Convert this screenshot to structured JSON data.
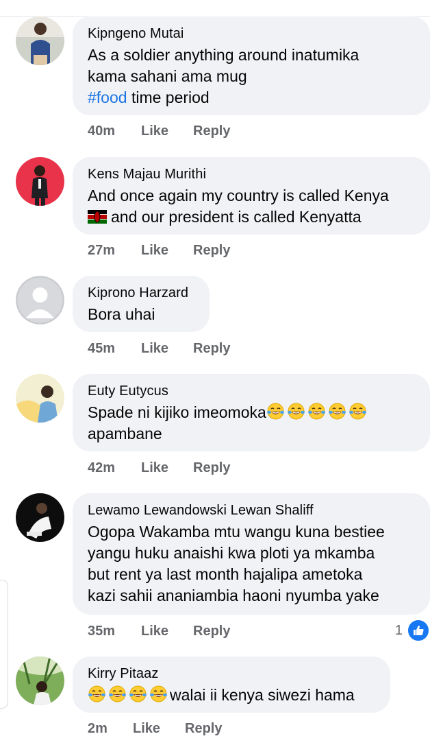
{
  "comments": [
    {
      "name": "Kipngeno Mutai",
      "line1": "As a soldier anything around inatumika",
      "line2": "kama sahani ama mug",
      "hashtag": "#food",
      "line3_rest": " time period",
      "time": "40m",
      "like": "Like",
      "reply": "Reply"
    },
    {
      "name": "Kens Majau Murithi",
      "line1": "And once again my country is called Kenya",
      "line2_rest": "and our president is called Kenyatta",
      "flag_icon": "kenya-flag-emoji",
      "time": "27m",
      "like": "Like",
      "reply": "Reply"
    },
    {
      "name": "Kiprono Harzard",
      "line1": "Bora uhai",
      "time": "45m",
      "like": "Like",
      "reply": "Reply"
    },
    {
      "name": "Euty Eutycus",
      "line1": "Spade ni kijiko imeomoka",
      "emoji_count": 5,
      "emoji_icon": "tears-of-joy-emoji",
      "line2": "apambane",
      "time": "42m",
      "like": "Like",
      "reply": "Reply"
    },
    {
      "name": "Lewamo Lewandowski Lewan Shaliff",
      "line1": "Ogopa Wakamba mtu wangu kuna bestiee",
      "line2": "yangu huku anaishi kwa ploti ya mkamba",
      "line3": "but rent ya last month hajalipa ametoka",
      "line4": "kazi sahii ananiambia haoni nyumba yake",
      "time": "35m",
      "like": "Like",
      "reply": "Reply",
      "reaction_count": "1",
      "reaction_icon": "like-thumb-icon"
    },
    {
      "name": "Kirry  Pitaaz",
      "emoji_count": 4,
      "emoji_icon": "tears-of-joy-emoji",
      "line1": "walai ii kenya siwezi hama",
      "time": "2m",
      "like": "Like",
      "reply": "Reply"
    }
  ],
  "colors": {
    "bubble": "#f0f2f5",
    "meta": "#65676b",
    "hashtag": "#1b74e4",
    "like_blue": "#1877f2"
  }
}
